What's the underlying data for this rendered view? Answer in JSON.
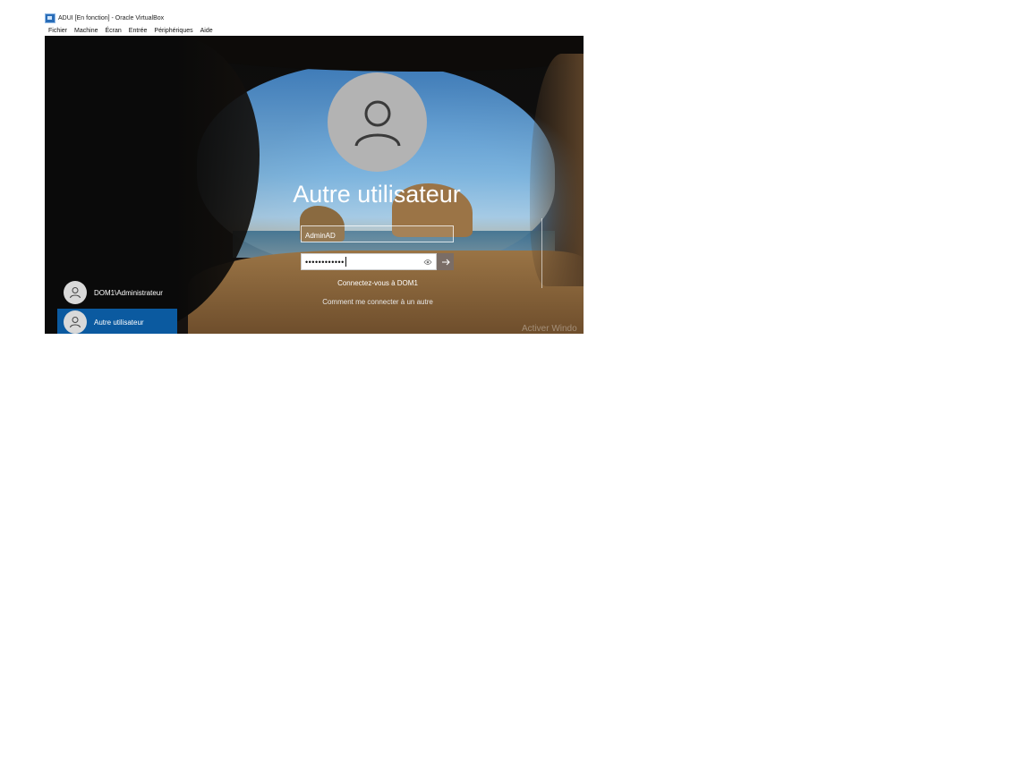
{
  "window": {
    "title": "ADUI [En fonction] - Oracle VirtualBox",
    "icon": "virtualbox-icon"
  },
  "menubar": {
    "items": [
      "Fichier",
      "Machine",
      "Écran",
      "Entrée",
      "Périphériques",
      "Aide"
    ]
  },
  "login": {
    "title": "Autre utilisateur",
    "avatar_icon": "user-icon",
    "username_value": "AdminAD",
    "password_mask": "••••••••••••",
    "reveal_icon": "eye-icon",
    "submit_icon": "arrow-right-icon",
    "sign_in_to": "Connectez-vous à DOM1",
    "how_to_link": "Comment me connecter à un autre"
  },
  "users": [
    {
      "name": "DOM1\\Administrateur",
      "selected": false
    },
    {
      "name": "Autre utilisateur",
      "selected": true
    }
  ],
  "watermark": "Activer Windo",
  "colors": {
    "selected_user_bg": "#0b5aa0",
    "submit_bg": "#7a6d66",
    "avatar_bg": "#b3b3b3"
  }
}
